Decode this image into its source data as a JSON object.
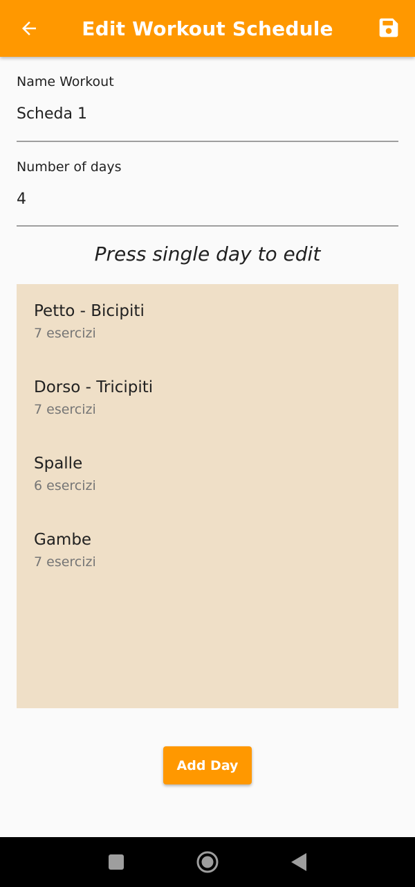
{
  "app_bar": {
    "title": "Edit Workout Schedule",
    "back_icon": "arrow-left-icon",
    "save_icon": "floppy-disk-save-icon",
    "color": "#ff9800"
  },
  "form": {
    "name_label": "Name Workout",
    "name_value": "Scheda 1",
    "days_label": "Number of days",
    "days_value": "4"
  },
  "hint": "Press single day to edit",
  "days": [
    {
      "name": "Petto - Bicipiti",
      "count": "7 esercizi"
    },
    {
      "name": "Dorso - Tricipiti",
      "count": "7 esercizi"
    },
    {
      "name": "Spalle",
      "count": "6 esercizi"
    },
    {
      "name": "Gambe",
      "count": "7 esercizi"
    }
  ],
  "add_button_label": "Add Day",
  "colors": {
    "accent": "#ff9800",
    "list_background": "#efdfc7",
    "page_background": "#fafafa"
  },
  "nav_bar": {
    "recents_icon": "square-recents-icon",
    "home_icon": "circle-home-icon",
    "back_icon": "triangle-back-icon"
  }
}
